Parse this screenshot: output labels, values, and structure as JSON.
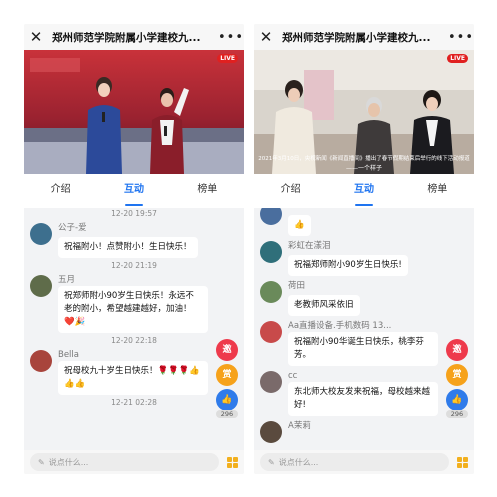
{
  "phones": [
    {
      "title": "郑州师范学院附属小学建校九...",
      "live_badge": "LIVE",
      "tabs": [
        "介绍",
        "互动",
        "榜单"
      ],
      "feed": {
        "ts1": "12-20 19:57",
        "m1_name": "公子-爱",
        "m1_text": "祝福附小！点赞附小！生日快乐！",
        "ts2": "12-20 21:19",
        "m2_name": "五月",
        "m2_text": "祝郑师附小90岁生日快乐！永远不老的附小，希望越建越好，加油！❤️🎉",
        "ts3": "12-20 22:18",
        "m3_name": "Bella",
        "m3_text": "祝母校九十岁生日快乐！🌹🌹🌹👍👍👍",
        "ts4": "12-21 02:28"
      },
      "floats": {
        "b1": "邀",
        "b2": "赏",
        "likes": "296"
      },
      "input_placeholder": "说点什么..."
    },
    {
      "title": "郑州师范学院附属小学建校九...",
      "live_badge": "LIVE",
      "caption": "2021年3月10日，央视新闻《新闻直播间》播出了春节假期结束后举行的线下活动报道",
      "caption2": "——一个样子",
      "tabs": [
        "介绍",
        "互动",
        "榜单"
      ],
      "feed": {
        "m0_text": "👍",
        "m1_name": "彩虹在漾泪",
        "m1_text": "祝福郑师附小90岁生日快乐!",
        "m2_name": "荷田",
        "m2_text": "老教师风采依旧",
        "m3_name": "Aa直播设备.手机数码 13...",
        "m3_text": "祝福附小90华诞生日快乐，桃李芬芳。",
        "m4_name": "cc",
        "m4_text": "东北师大校友发来祝福，母校越来越好!",
        "m5_name": "A茉莉"
      },
      "floats": {
        "b1": "邀",
        "b2": "赏",
        "likes": "296"
      },
      "input_placeholder": "说点什么..."
    }
  ]
}
